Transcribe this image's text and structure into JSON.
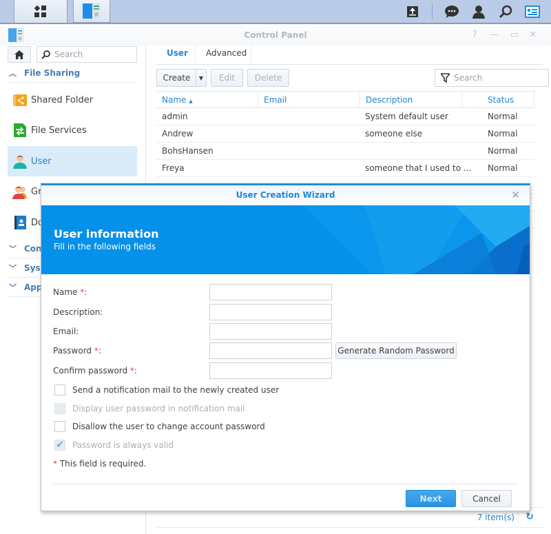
{
  "taskbar": {
    "main_menu_icon": "apps-grid-icon",
    "open_app_icon": "control-panel-icon",
    "right_icons": [
      "upload-icon",
      "chat-icon",
      "user-icon",
      "search-icon",
      "widgets-icon"
    ]
  },
  "window": {
    "title": "Control Panel",
    "controls": [
      "help",
      "minimize",
      "restore",
      "close"
    ]
  },
  "sidebar": {
    "search_placeholder": "Search",
    "section_file_sharing": "File Sharing",
    "items": [
      {
        "label": "Shared Folder",
        "icon": "shared-folder-icon"
      },
      {
        "label": "File Services",
        "icon": "file-services-icon"
      },
      {
        "label": "User",
        "icon": "user-icon",
        "selected": true
      },
      {
        "label": "Group",
        "visible_text": "Gr",
        "icon": "group-icon"
      },
      {
        "label": "Domain/LDAP",
        "visible_text": "Do",
        "icon": "domain-icon"
      }
    ],
    "collapsed_sections": [
      {
        "visible_text": "Con"
      },
      {
        "visible_text": "Sys"
      },
      {
        "visible_text": "App"
      }
    ]
  },
  "main": {
    "tabs": [
      {
        "label": "User",
        "active": true
      },
      {
        "label": "Advanced",
        "active": false
      }
    ],
    "toolbar": {
      "create": "Create",
      "edit": "Edit",
      "delete": "Delete",
      "search_placeholder": "Search"
    },
    "table": {
      "columns": [
        "Name",
        "Email",
        "Description",
        "Status"
      ],
      "sort_column": "Name",
      "sort_dir": "asc",
      "rows": [
        {
          "name": "admin",
          "email": "",
          "description": "System default user",
          "status": "Normal"
        },
        {
          "name": "Andrew",
          "email": "",
          "description": "someone else",
          "status": "Normal"
        },
        {
          "name": "BohsHansen",
          "email": "",
          "description": "",
          "status": "Normal"
        },
        {
          "name": "Freya",
          "email": "",
          "description": "someone that I used to ...",
          "status": "Normal"
        }
      ]
    },
    "items_count": "7 item(s)"
  },
  "dialog": {
    "title": "User Creation Wizard",
    "banner_title": "User information",
    "banner_subtitle": "Fill in the following fields",
    "fields": [
      {
        "label": "Name",
        "required": true,
        "value": ""
      },
      {
        "label": "Description",
        "required": false,
        "value": ""
      },
      {
        "label": "Email",
        "required": false,
        "value": ""
      },
      {
        "label": "Password",
        "required": true,
        "value": ""
      },
      {
        "label": "Confirm password",
        "required": true,
        "value": ""
      }
    ],
    "generate_password": "Generate Random Password",
    "checkboxes": [
      {
        "label": "Send a notification mail to the newly created user",
        "checked": false,
        "disabled": false
      },
      {
        "label": "Display user password in notification mail",
        "checked": false,
        "disabled": true
      },
      {
        "label": "Disallow the user to change account password",
        "checked": false,
        "disabled": false
      },
      {
        "label": "Password is always valid",
        "checked": true,
        "disabled": true
      }
    ],
    "required_note": "This field is required.",
    "required_mark": "*",
    "next": "Next",
    "cancel": "Cancel"
  },
  "colors": {
    "accent": "#2585d4",
    "banner": "#0590ea",
    "required": "#e64545",
    "selected_bg": "#daebfa"
  }
}
